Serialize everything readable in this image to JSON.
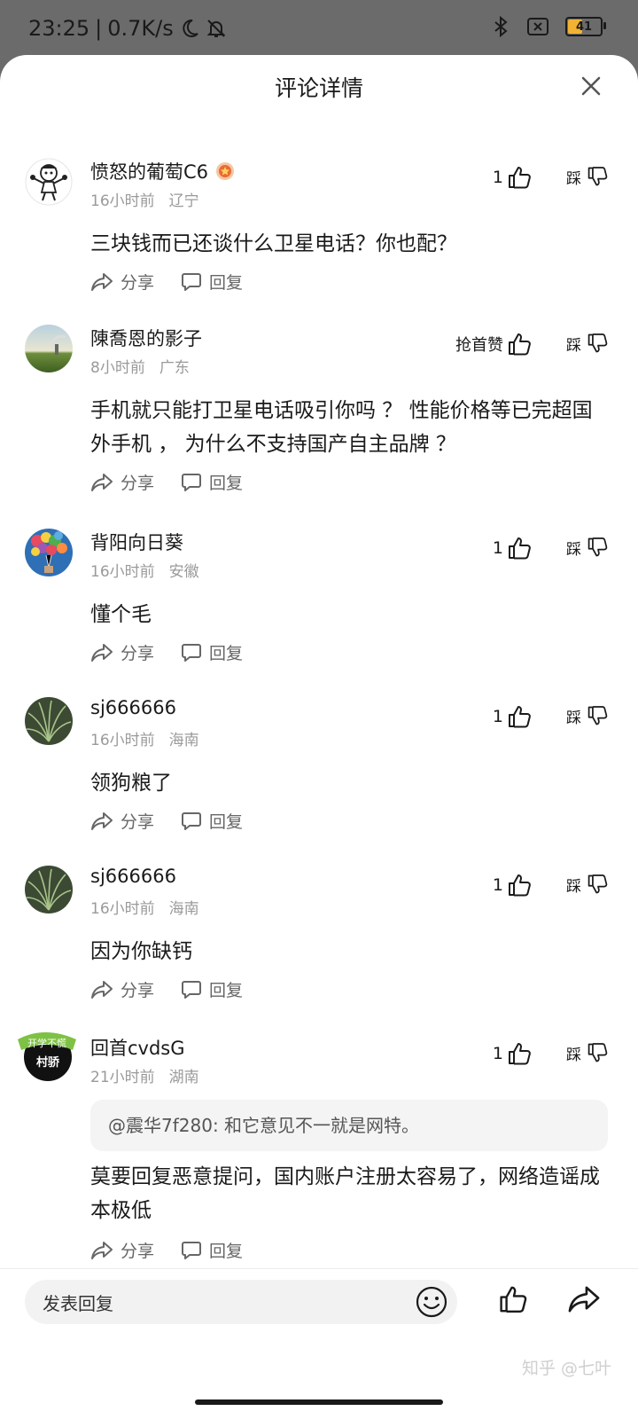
{
  "status": {
    "time": "23:25",
    "separator": "|",
    "speed": "0.7K/s",
    "battery": "41",
    "battery_level": 0.41
  },
  "sheet": {
    "title": "评论详情"
  },
  "labels": {
    "share": "分享",
    "reply": "回复",
    "dislike": "踩"
  },
  "comments": [
    {
      "name": "愤怒的葡萄C6",
      "time": "16小时前",
      "location": "辽宁",
      "likes": "1",
      "text": "三块钱而已还谈什么卫星电话？你也配？",
      "avatar": "cartoon-avatar"
    },
    {
      "name": "陳喬恩的影子",
      "time": "8小时前",
      "location": "广东",
      "likes": "抢首赞",
      "text": "手机就只能打卫星电话吸引你吗 ？ 性能价格等已完超国外手机 ， 为什么不支持国产自主品牌 ？",
      "avatar": "landscape-avatar"
    },
    {
      "name": "背阳向日葵",
      "time": "16小时前",
      "location": "安徽",
      "likes": "1",
      "text": "懂个毛",
      "avatar": "balloons-avatar"
    },
    {
      "name": "sj666666",
      "time": "16小时前",
      "location": "海南",
      "likes": "1",
      "text": "领狗粮了",
      "avatar": "grass-avatar"
    },
    {
      "name": "sj666666",
      "time": "16小时前",
      "location": "海南",
      "likes": "1",
      "text": "因为你缺钙",
      "avatar": "grass-avatar"
    },
    {
      "name": "回首cvdsG",
      "time": "21小时前",
      "location": "湖南",
      "likes": "1",
      "quote": "@震华7f280: 和它意见不一就是网特。",
      "text": "莫要回复恶意提问，国内账户注册太容易了，网络造谣成本极低",
      "avatar": "badge-avatar",
      "avatar_badge": "开学不慌",
      "avatar_text": "村骄"
    }
  ],
  "bottom": {
    "placeholder": "发表回复"
  },
  "watermark": "知乎 @七叶"
}
